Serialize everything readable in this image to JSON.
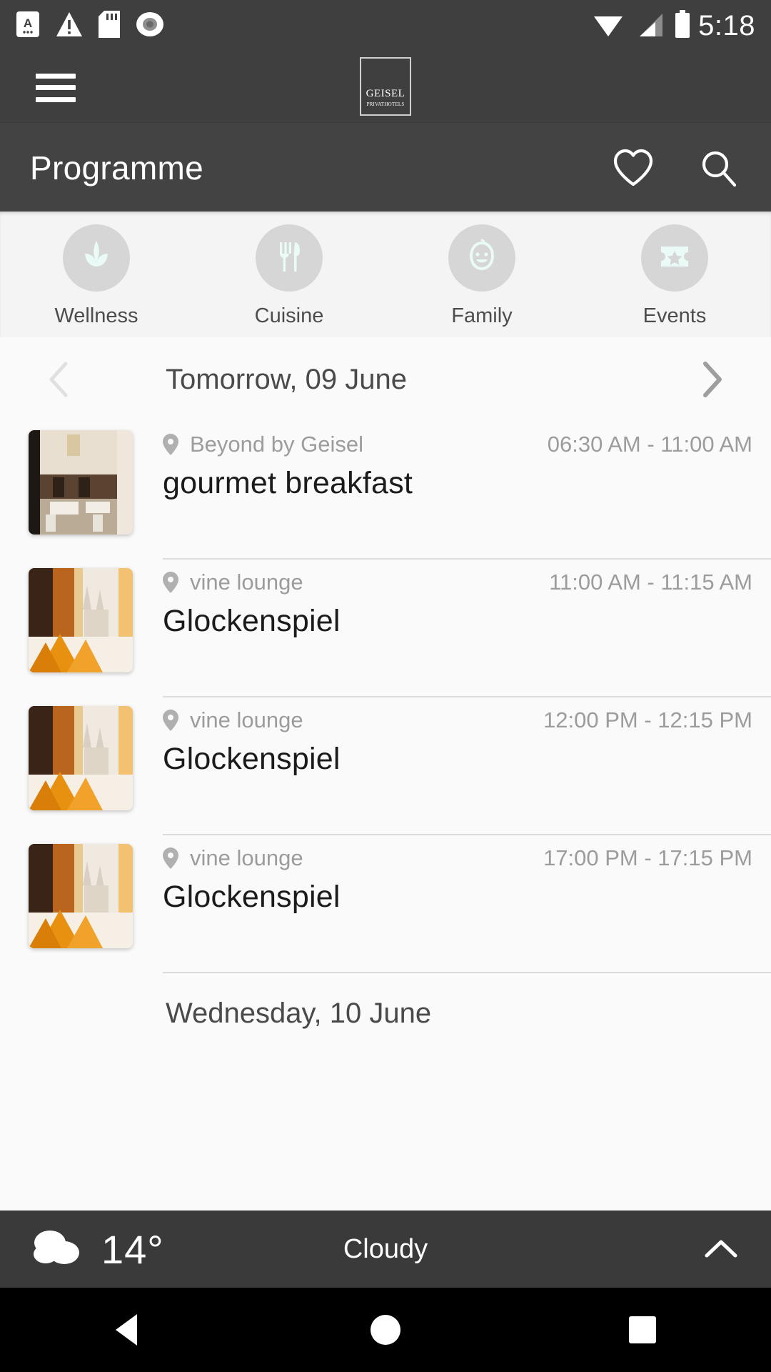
{
  "statusbar": {
    "time": "5:18",
    "icons": [
      "app-a-icon",
      "warning-triangle-icon",
      "sd-card-icon",
      "record-circle-icon"
    ],
    "right_icons": [
      "wifi-icon",
      "cellular-signal-icon",
      "battery-icon"
    ]
  },
  "appbar": {
    "menu_icon": "hamburger-menu-icon",
    "logo_main": "GEISEL",
    "logo_sub": "PRIVATHOTELS"
  },
  "titlebar": {
    "title": "Programme",
    "favorite_icon": "heart-outline-icon",
    "search_icon": "search-icon"
  },
  "categories": [
    {
      "label": "Wellness",
      "icon": "leaf-spa-icon"
    },
    {
      "label": "Cuisine",
      "icon": "fork-knife-icon"
    },
    {
      "label": "Family",
      "icon": "baby-face-icon"
    },
    {
      "label": "Events",
      "icon": "ticket-star-icon"
    }
  ],
  "daynav": {
    "prev_icon": "chevron-left-icon",
    "next_icon": "chevron-right-icon",
    "label": "Tomorrow, 09 June",
    "prev_disabled": true
  },
  "events": [
    {
      "venue": "Beyond by Geisel",
      "title": "gourmet breakfast",
      "time": "06:30 AM - 11:00 AM",
      "thumb": "restaurant-dining-room"
    },
    {
      "venue": "vine lounge",
      "title": "Glockenspiel",
      "time": "11:00 AM - 11:15 AM",
      "thumb": "lounge-cathedral-view"
    },
    {
      "venue": "vine lounge",
      "title": "Glockenspiel",
      "time": "12:00 PM - 12:15 PM",
      "thumb": "lounge-cathedral-view"
    },
    {
      "venue": "vine lounge",
      "title": "Glockenspiel",
      "time": "17:00 PM - 17:15 PM",
      "thumb": "lounge-cathedral-view"
    }
  ],
  "next_day_label": "Wednesday, 10 June",
  "weather": {
    "icon": "cloudy-icon",
    "temperature": "14°",
    "condition": "Cloudy",
    "expand_icon": "chevron-up-icon"
  },
  "navbar": {
    "back": "back-triangle-icon",
    "home": "home-circle-icon",
    "recents": "recents-square-icon"
  },
  "colors": {
    "chrome_dark": "#3f3f3f",
    "titlebar": "#434343",
    "strip_bg": "#f4f4f4",
    "list_bg": "#fafafa",
    "muted_text": "#9c9c9c",
    "title_text": "#1b1b1b",
    "circle_bg": "#d6d6d6",
    "icon_pale": "#eafaf6"
  }
}
